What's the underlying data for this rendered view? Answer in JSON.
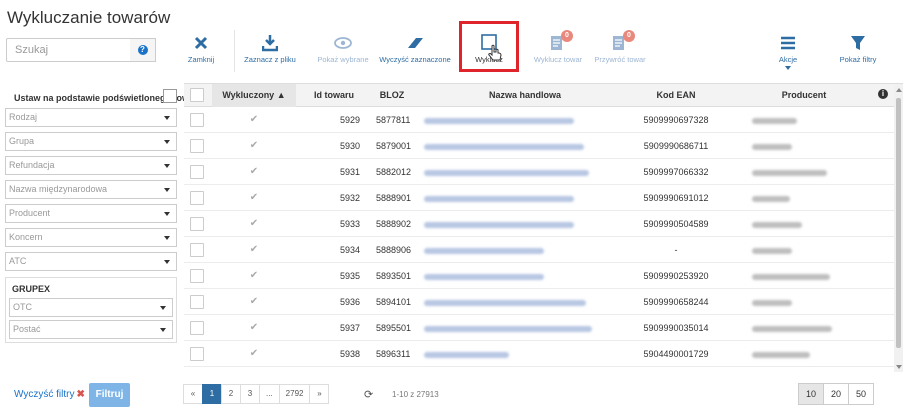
{
  "page": {
    "title": "Wykluczanie towarów"
  },
  "search": {
    "placeholder": "Szukaj"
  },
  "filters": {
    "set_label": "Ustaw na podstawie podświetlonego towaru",
    "selects": [
      "Rodzaj",
      "Grupa",
      "Refundacja",
      "Nazwa międzynarodowa",
      "Producent",
      "Koncern",
      "ATC"
    ],
    "grupex": {
      "label": "GRUPEX",
      "selects": [
        "OTC",
        "Postać"
      ]
    },
    "clear_label": "Wyczyść filtry",
    "filter_button": "Filtruj"
  },
  "toolbar": {
    "close": "Zamknij",
    "select_from_file": "Zaznacz z pliku",
    "show_selected": "Pokaż wybrane",
    "clear_selected": "Wyczyść zaznaczone",
    "exclude": "Wyklucz",
    "exclude_item": "Wyklucz towar",
    "exclude_item_badge": "0",
    "restore_item": "Przywróć towar",
    "restore_item_badge": "0",
    "actions": "Akcje",
    "show_filters": "Pokaż filtry"
  },
  "colors": {
    "accent": "#2e6da4",
    "highlight": "#e0242b",
    "badge": "#e9887c"
  },
  "table": {
    "columns": {
      "excluded": "Wykluczony",
      "id": "Id towaru",
      "bloz": "BLOZ",
      "name": "Nazwa handlowa",
      "ean": "Kod EAN",
      "producer": "Producent"
    },
    "rows": [
      {
        "id": "5929",
        "bloz": "5877811",
        "ean": "5909990697328"
      },
      {
        "id": "5930",
        "bloz": "5879001",
        "ean": "5909990686711"
      },
      {
        "id": "5931",
        "bloz": "5882012",
        "ean": "5909997066332"
      },
      {
        "id": "5932",
        "bloz": "5888901",
        "ean": "5909990691012"
      },
      {
        "id": "5933",
        "bloz": "5888902",
        "ean": "5909990504589"
      },
      {
        "id": "5934",
        "bloz": "5888906",
        "ean": "-"
      },
      {
        "id": "5935",
        "bloz": "5893501",
        "ean": "5909990253920"
      },
      {
        "id": "5936",
        "bloz": "5894101",
        "ean": "5909990658244"
      },
      {
        "id": "5937",
        "bloz": "5895501",
        "ean": "5909990035014"
      },
      {
        "id": "5938",
        "bloz": "5896311",
        "ean": "5904490001729"
      }
    ]
  },
  "pagination": {
    "first": "«",
    "p1": "1",
    "p2": "2",
    "p3": "3",
    "dots": "...",
    "last_page": "2792",
    "next": "»",
    "range": "1-10 z 27913",
    "sizes": [
      "10",
      "20",
      "50"
    ]
  }
}
